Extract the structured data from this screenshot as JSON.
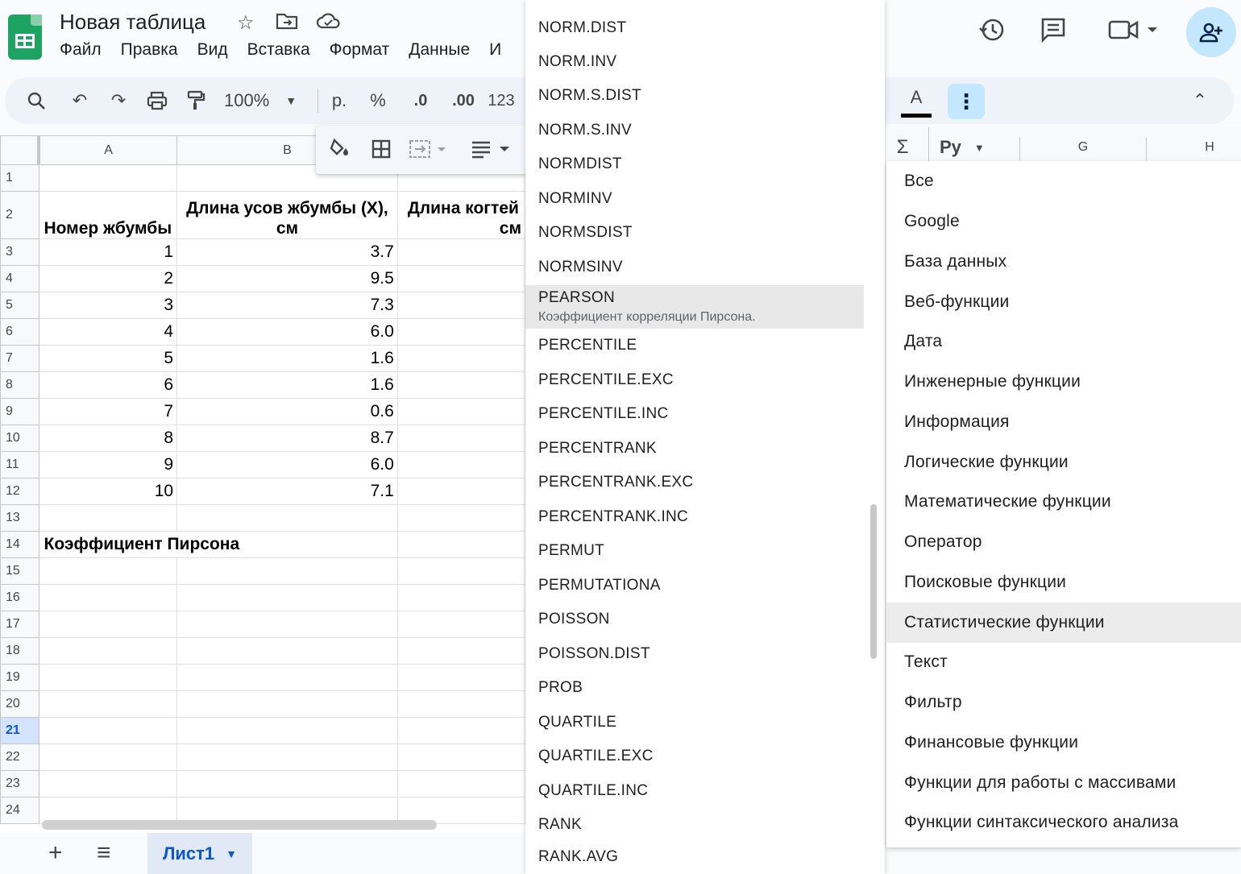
{
  "header": {
    "title": "Новая таблица",
    "menu": [
      "Файл",
      "Правка",
      "Вид",
      "Вставка",
      "Формат",
      "Данные",
      "И"
    ],
    "icons": [
      "star-icon",
      "move-to-folder-icon",
      "cloud-saved-icon",
      "history-icon",
      "comments-icon",
      "video-call-icon",
      "share-icon"
    ]
  },
  "toolbar": {
    "zoom": "100%",
    "currency": "р.",
    "percent": "%",
    "dec_decrease": ".0",
    "dec_increase": ".00",
    "number_format": "123",
    "text_color_label": "A",
    "sigma": "Σ",
    "font_short": "Py"
  },
  "grid": {
    "columns": [
      "A",
      "B",
      "",
      "G",
      "H"
    ],
    "header_a": "Номер жбумбы",
    "header_b": "Длина усов жбумбы (X), см",
    "header_c_line1": "Длина когтей",
    "header_c_line2": "см",
    "rows": [
      {
        "n": "1",
        "a": "1",
        "b": "3.7"
      },
      {
        "n": "2",
        "a": "2",
        "b": "9.5"
      },
      {
        "n": "3",
        "a": "3",
        "b": "7.3"
      },
      {
        "n": "4",
        "a": "4",
        "b": "6.0"
      },
      {
        "n": "5",
        "a": "5",
        "b": "1.6"
      },
      {
        "n": "6",
        "a": "6",
        "b": "1.6"
      },
      {
        "n": "7",
        "a": "7",
        "b": "0.6"
      },
      {
        "n": "8",
        "a": "8",
        "b": "8.7"
      },
      {
        "n": "9",
        "a": "9",
        "b": "6.0"
      },
      {
        "n": "10",
        "a": "10",
        "b": "7.1"
      }
    ],
    "row_numbers": [
      "1",
      "2",
      "3",
      "4",
      "5",
      "6",
      "7",
      "8",
      "9",
      "10",
      "11",
      "12",
      "13",
      "14",
      "15",
      "16",
      "17",
      "18",
      "19",
      "20",
      "21",
      "22",
      "23",
      "24"
    ],
    "pearson_label": "Коэффициент Пирсона",
    "selected_row": "21"
  },
  "sheet_tabs": {
    "active": "Лист1"
  },
  "function_list": {
    "items": [
      "NORM.DIST",
      "NORM.INV",
      "NORM.S.DIST",
      "NORM.S.INV",
      "NORMDIST",
      "NORMINV",
      "NORMSDIST",
      "NORMSINV",
      "PERCENTILE",
      "PERCENTILE.EXC",
      "PERCENTILE.INC",
      "PERCENTRANK",
      "PERCENTRANK.EXC",
      "PERCENTRANK.INC",
      "PERMUT",
      "PERMUTATIONA",
      "POISSON",
      "POISSON.DIST",
      "PROB",
      "QUARTILE",
      "QUARTILE.EXC",
      "QUARTILE.INC",
      "RANK",
      "RANK.AVG"
    ],
    "highlighted": {
      "name": "PEARSON",
      "description": "Коэффициент корреляции Пирсона."
    }
  },
  "categories": {
    "items": [
      "Все",
      "Google",
      "База данных",
      "Веб-функции",
      "Дата",
      "Инженерные функции",
      "Информация",
      "Логические функции",
      "Математические функции",
      "Оператор",
      "Поисковые функции",
      "Статистические функции",
      "Текст",
      "Фильтр",
      "Финансовые функции",
      "Функции для работы с массивами",
      "Функции синтаксического анализа"
    ],
    "selected": "Статистические функции"
  }
}
